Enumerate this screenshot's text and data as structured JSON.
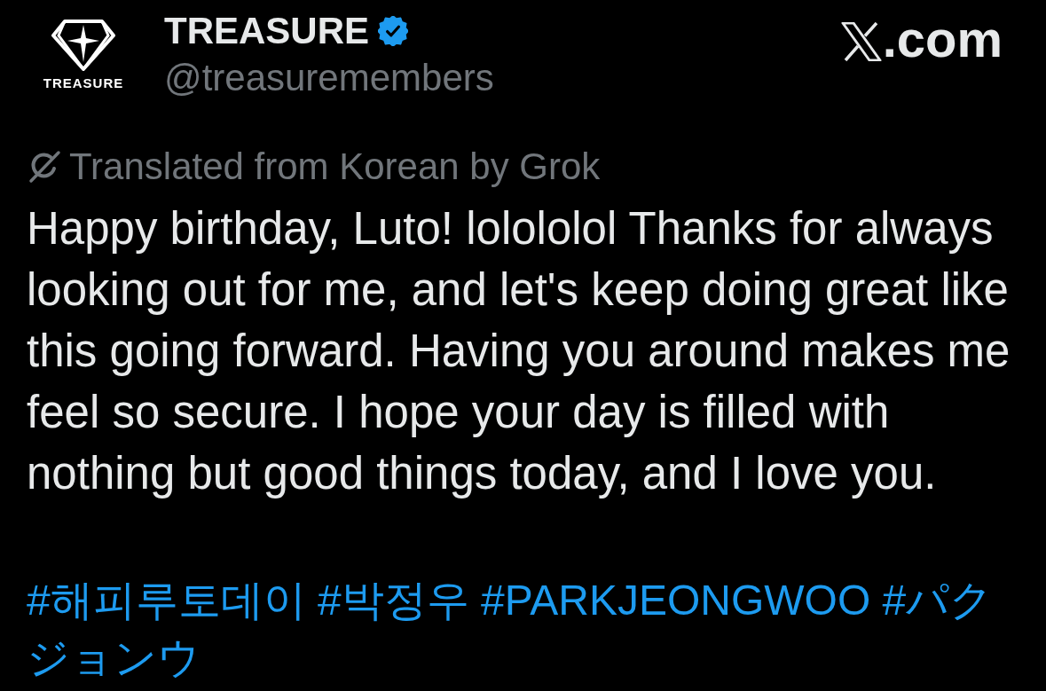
{
  "header": {
    "logo_text": "TREASURE",
    "name": "TREASURE",
    "verified": true,
    "handle": "@treasuremembers",
    "site_suffix": ".com"
  },
  "translation_note": "Translated from Korean by Grok",
  "body": "Happy birthday, Luto! lolololol Thanks for always looking out for me, and let's keep doing great like this going forward. Having you around makes me feel so secure. I hope your day is filled with nothing but good things today, and I love you.",
  "hashtags": "#해피루토데이 #박정우 #PARKJEONGWOO #パクジョンウ"
}
